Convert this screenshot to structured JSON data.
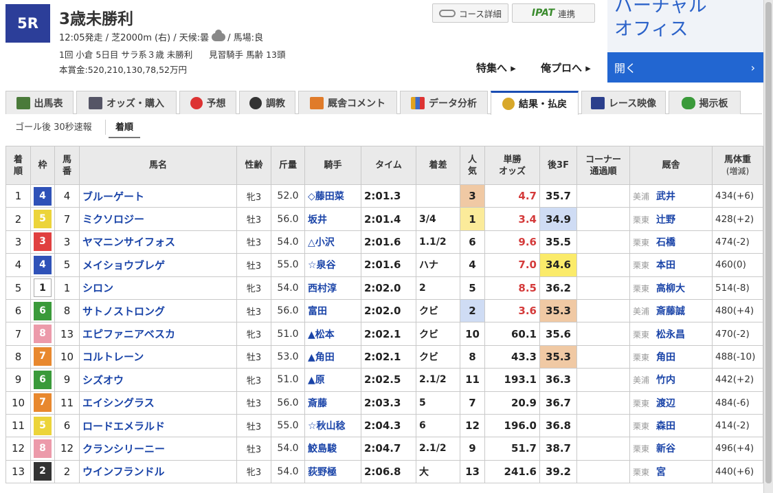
{
  "header": {
    "race_no": "5R",
    "title": "3歳未勝利",
    "info1_pre": "12:05発走 / 芝2000m (右) / 天候:曇",
    "info1_post": "/ 馬場:良",
    "info2_left": "1回 小倉 5日目 サラ系３歳 未勝利",
    "info2_right": "見習騎手 馬齢 13頭",
    "prize": "本賞金:520,210,130,78,52万円"
  },
  "buttons": {
    "course": "コース詳細",
    "ipat_logo": "IPAT",
    "ipat_label": "連携",
    "special": "特集へ ▸",
    "pro": "俺プロへ ▸"
  },
  "virtual": {
    "title": "バーチャル\nオフィス",
    "open": "開く",
    "arrow": "›"
  },
  "tabs": [
    {
      "label": "出馬表"
    },
    {
      "label": "オッズ・購入"
    },
    {
      "label": "予想"
    },
    {
      "label": "調教"
    },
    {
      "label": "厩舎コメント"
    },
    {
      "label": "データ分析"
    },
    {
      "label": "結果・払戻"
    },
    {
      "label": "レース映像"
    },
    {
      "label": "掲示板"
    }
  ],
  "subtabs": {
    "quick": "ゴール後 30秒速報",
    "order": "着順"
  },
  "table": {
    "headers": {
      "rank": [
        "着",
        "順"
      ],
      "waku": "枠",
      "num": [
        "馬",
        "番"
      ],
      "name": "馬名",
      "sex": "性齢",
      "weight": "斤量",
      "jockey": "騎手",
      "time": "タイム",
      "margin": "着差",
      "pop": [
        "人",
        "気"
      ],
      "odds": [
        "単勝",
        "オッズ"
      ],
      "last3f": "後3F",
      "corner": [
        "コーナー",
        "通過順"
      ],
      "stable": "厩舎",
      "bw": "馬体重",
      "bw_sub": "(増減)"
    },
    "rows": [
      {
        "rank": "1",
        "waku": "4",
        "num": "4",
        "name": "ブルーゲート",
        "sex": "牝3",
        "weight": "52.0",
        "jockey": "◇藤田菜",
        "time": "2:01.3",
        "margin": "",
        "pop": "3",
        "odds": "4.7",
        "last3f": "35.7",
        "area": "美浦",
        "trainer": "武井",
        "bw": "434(+6)"
      },
      {
        "rank": "2",
        "waku": "5",
        "num": "7",
        "name": "ミクソロジー",
        "sex": "牡3",
        "weight": "56.0",
        "jockey": "坂井",
        "time": "2:01.4",
        "margin": "3/4",
        "pop": "1",
        "odds": "3.4",
        "last3f": "34.9",
        "area": "栗東",
        "trainer": "辻野",
        "bw": "428(+2)"
      },
      {
        "rank": "3",
        "waku": "3",
        "num": "3",
        "name": "ヤマニンサイフォス",
        "sex": "牡3",
        "weight": "54.0",
        "jockey": "△小沢",
        "time": "2:01.6",
        "margin": "1.1/2",
        "pop": "6",
        "odds": "9.6",
        "last3f": "35.5",
        "area": "栗東",
        "trainer": "石橋",
        "bw": "474(-2)"
      },
      {
        "rank": "4",
        "waku": "4",
        "num": "5",
        "name": "メイショウブレゲ",
        "sex": "牡3",
        "weight": "55.0",
        "jockey": "☆泉谷",
        "time": "2:01.6",
        "margin": "ハナ",
        "pop": "4",
        "odds": "7.0",
        "last3f": "34.6",
        "area": "栗東",
        "trainer": "本田",
        "bw": "460(0)"
      },
      {
        "rank": "5",
        "waku": "1",
        "num": "1",
        "name": "シロン",
        "sex": "牝3",
        "weight": "54.0",
        "jockey": "西村淳",
        "time": "2:02.0",
        "margin": "2",
        "pop": "5",
        "odds": "8.5",
        "last3f": "36.2",
        "area": "栗東",
        "trainer": "高柳大",
        "bw": "514(-8)"
      },
      {
        "rank": "6",
        "waku": "6",
        "num": "8",
        "name": "サトノストロング",
        "sex": "牡3",
        "weight": "56.0",
        "jockey": "富田",
        "time": "2:02.0",
        "margin": "クビ",
        "pop": "2",
        "odds": "3.6",
        "last3f": "35.3",
        "area": "美浦",
        "trainer": "斎藤誠",
        "bw": "480(+4)"
      },
      {
        "rank": "7",
        "waku": "8",
        "num": "13",
        "name": "エピファニアベスカ",
        "sex": "牝3",
        "weight": "51.0",
        "jockey": "▲松本",
        "time": "2:02.1",
        "margin": "クビ",
        "pop": "10",
        "odds": "60.1",
        "last3f": "35.6",
        "area": "栗東",
        "trainer": "松永昌",
        "bw": "470(-2)"
      },
      {
        "rank": "8",
        "waku": "7",
        "num": "10",
        "name": "コルトレーン",
        "sex": "牡3",
        "weight": "53.0",
        "jockey": "▲角田",
        "time": "2:02.1",
        "margin": "クビ",
        "pop": "8",
        "odds": "43.3",
        "last3f": "35.3",
        "area": "栗東",
        "trainer": "角田",
        "bw": "488(-10)"
      },
      {
        "rank": "9",
        "waku": "6",
        "num": "9",
        "name": "シズオウ",
        "sex": "牝3",
        "weight": "51.0",
        "jockey": "▲原",
        "time": "2:02.5",
        "margin": "2.1/2",
        "pop": "11",
        "odds": "193.1",
        "last3f": "36.3",
        "area": "美浦",
        "trainer": "竹内",
        "bw": "442(+2)"
      },
      {
        "rank": "10",
        "waku": "7",
        "num": "11",
        "name": "エイシングラス",
        "sex": "牡3",
        "weight": "56.0",
        "jockey": "斎藤",
        "time": "2:03.3",
        "margin": "5",
        "pop": "7",
        "odds": "20.9",
        "last3f": "36.7",
        "area": "栗東",
        "trainer": "渡辺",
        "bw": "484(-6)"
      },
      {
        "rank": "11",
        "waku": "5",
        "num": "6",
        "name": "ロードエメラルド",
        "sex": "牡3",
        "weight": "55.0",
        "jockey": "☆秋山稔",
        "time": "2:04.3",
        "margin": "6",
        "pop": "12",
        "odds": "196.0",
        "last3f": "36.8",
        "area": "栗東",
        "trainer": "森田",
        "bw": "414(-2)"
      },
      {
        "rank": "12",
        "waku": "8",
        "num": "12",
        "name": "クランシリーニー",
        "sex": "牡3",
        "weight": "54.0",
        "jockey": "鮫島駿",
        "time": "2:04.7",
        "margin": "2.1/2",
        "pop": "9",
        "odds": "51.7",
        "last3f": "38.7",
        "area": "栗東",
        "trainer": "新谷",
        "bw": "496(+4)"
      },
      {
        "rank": "13",
        "waku": "2",
        "num": "2",
        "name": "ウインフランドル",
        "sex": "牝3",
        "weight": "54.0",
        "jockey": "荻野極",
        "time": "2:06.8",
        "margin": "大",
        "pop": "13",
        "odds": "241.6",
        "last3f": "39.2",
        "area": "栗東",
        "trainer": "宮",
        "bw": "440(+6)"
      }
    ]
  }
}
